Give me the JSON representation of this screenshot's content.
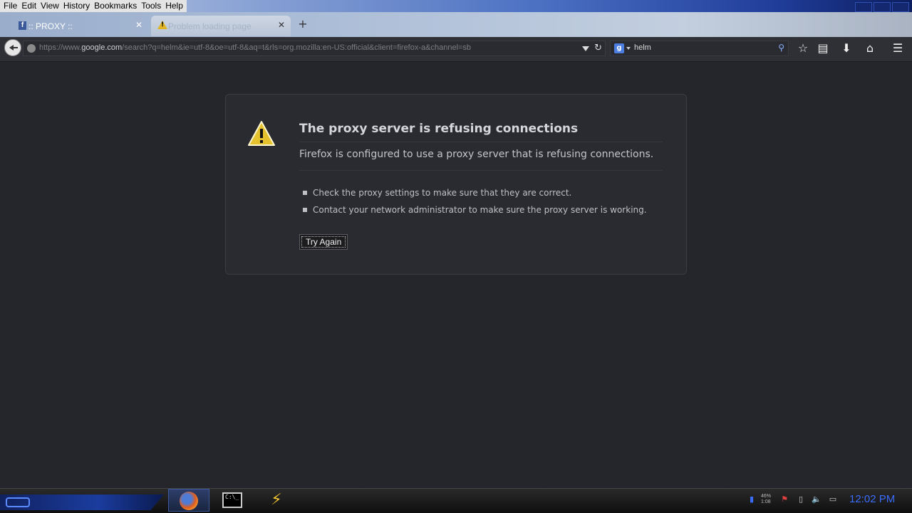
{
  "menubar": {
    "items": [
      "File",
      "Edit",
      "View",
      "History",
      "Bookmarks",
      "Tools",
      "Help"
    ]
  },
  "tabs": [
    {
      "title": ":: PROXY ::",
      "icon": "facebook-icon",
      "active": false
    },
    {
      "title": "Problem loading page",
      "icon": "warning-icon",
      "active": true
    }
  ],
  "navbar": {
    "url_prefix": "https://www.",
    "url_host": "google.com",
    "url_rest": "/search?q=helm&ie=utf-8&oe=utf-8&aq=t&rls=org.mozilla:en-US:official&client=firefox-a&channel=sb",
    "search_engine_icon": "g",
    "search_value": "helm"
  },
  "error": {
    "title": "The proxy server is refusing connections",
    "description": "Firefox is configured to use a proxy server that is refusing connections.",
    "suggestions": [
      "Check the proxy settings to make sure that they are correct.",
      "Contact your network administrator to make sure the proxy server is working."
    ],
    "button_label": "Try Again"
  },
  "taskbar": {
    "cmd_prompt": "C:\\_",
    "net_stat_top": "46%",
    "net_stat_bottom": "1:08",
    "clock": "12:02 PM"
  },
  "colors": {
    "page_bg": "#25262b",
    "clock": "#3a6cff",
    "warning": "#e0b422"
  }
}
